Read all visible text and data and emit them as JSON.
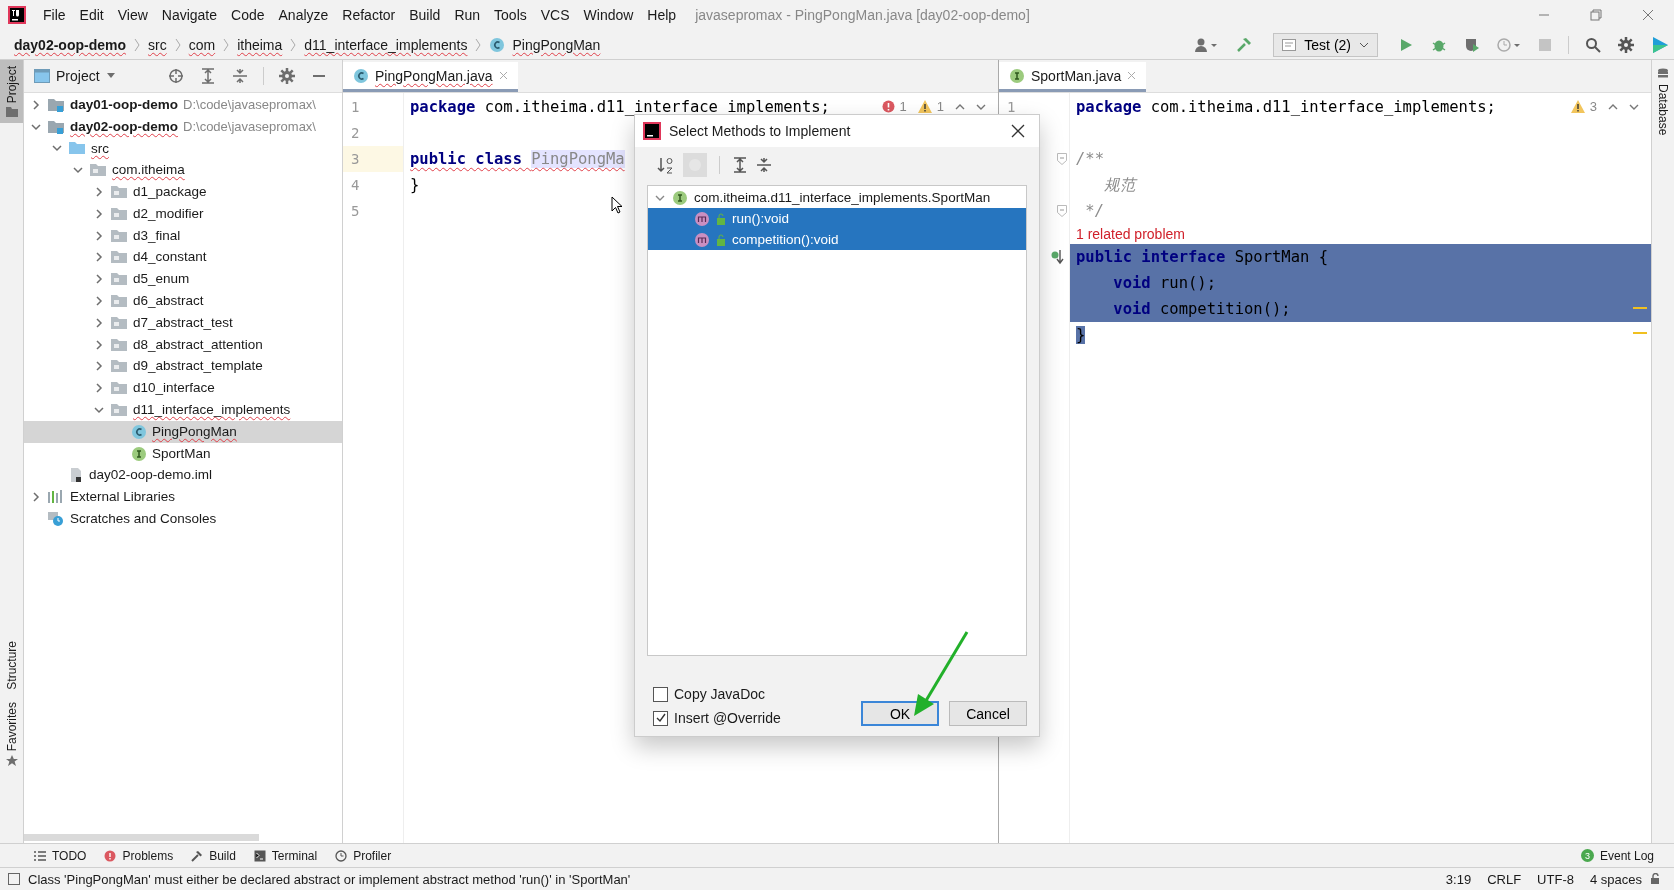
{
  "menu": [
    "File",
    "Edit",
    "View",
    "Navigate",
    "Code",
    "Analyze",
    "Refactor",
    "Build",
    "Run",
    "Tools",
    "VCS",
    "Window",
    "Help"
  ],
  "window": {
    "title": "javasepromax - PingPongMan.java [day02-oop-demo]"
  },
  "breadcrumbs": [
    {
      "label": "day02-oop-demo",
      "kind": "module",
      "error": true
    },
    {
      "label": "src",
      "kind": "plain",
      "error": true
    },
    {
      "label": "com",
      "kind": "plain",
      "error": true
    },
    {
      "label": "itheima",
      "kind": "plain",
      "error": true
    },
    {
      "label": "d11_interface_implements",
      "kind": "plain",
      "error": true
    },
    {
      "label": "PingPongMan",
      "kind": "class",
      "error": true
    }
  ],
  "run_config": {
    "label": "Test (2)"
  },
  "left_stripe": [
    {
      "label": "Project",
      "selected": true
    },
    {
      "label": "Structure",
      "selected": false
    },
    {
      "label": "Favorites",
      "selected": false
    }
  ],
  "right_stripe": [
    {
      "label": "Database"
    }
  ],
  "project": {
    "title": "Project",
    "tree": [
      {
        "label": "day01-oop-demo",
        "kind": "module",
        "path": "D:\\code\\javasepromax\\",
        "expanded": false,
        "selected": false,
        "error": false
      },
      {
        "label": "day02-oop-demo",
        "kind": "module",
        "path": "D:\\code\\javasepromax\\",
        "expanded": true,
        "selected": false,
        "error": true,
        "children": [
          {
            "label": "src",
            "kind": "source",
            "expanded": true,
            "selected": false,
            "error": true,
            "children": [
              {
                "label": "com.itheima",
                "kind": "package",
                "expanded": true,
                "selected": false,
                "error": true,
                "children": [
                  {
                    "label": "d1_package",
                    "kind": "package",
                    "expanded": false,
                    "selected": false,
                    "error": false
                  },
                  {
                    "label": "d2_modifier",
                    "kind": "package",
                    "expanded": false,
                    "selected": false,
                    "error": false
                  },
                  {
                    "label": "d3_final",
                    "kind": "package",
                    "expanded": false,
                    "selected": false,
                    "error": false
                  },
                  {
                    "label": "d4_constant",
                    "kind": "package",
                    "expanded": false,
                    "selected": false,
                    "error": false
                  },
                  {
                    "label": "d5_enum",
                    "kind": "package",
                    "expanded": false,
                    "selected": false,
                    "error": false
                  },
                  {
                    "label": "d6_abstract",
                    "kind": "package",
                    "expanded": false,
                    "selected": false,
                    "error": false
                  },
                  {
                    "label": "d7_abstract_test",
                    "kind": "package",
                    "expanded": false,
                    "selected": false,
                    "error": false
                  },
                  {
                    "label": "d8_abstract_attention",
                    "kind": "package",
                    "expanded": false,
                    "selected": false,
                    "error": false
                  },
                  {
                    "label": "d9_abstract_template",
                    "kind": "package",
                    "expanded": false,
                    "selected": false,
                    "error": false
                  },
                  {
                    "label": "d10_interface",
                    "kind": "package",
                    "expanded": false,
                    "selected": false,
                    "error": false
                  },
                  {
                    "label": "d11_interface_implements",
                    "kind": "package",
                    "expanded": true,
                    "selected": false,
                    "error": true,
                    "children": [
                      {
                        "label": "PingPongMan",
                        "kind": "class",
                        "selected": true,
                        "error": true
                      },
                      {
                        "label": "SportMan",
                        "kind": "interface",
                        "selected": false,
                        "error": false
                      }
                    ]
                  }
                ]
              }
            ]
          },
          {
            "label": "day02-oop-demo.iml",
            "kind": "file",
            "selected": false,
            "error": false
          }
        ]
      },
      {
        "label": "External Libraries",
        "kind": "libraries",
        "expanded": false,
        "selected": false,
        "error": false
      },
      {
        "label": "Scratches and Consoles",
        "kind": "scratches",
        "selected": false,
        "error": false
      }
    ]
  },
  "editor_left": {
    "tab": {
      "label": "PingPongMan.java",
      "kind": "class",
      "error": true
    },
    "errors": "1",
    "warnings": "1",
    "lines": [
      {
        "number": "1",
        "current": false,
        "error": false,
        "tokens": [
          {
            "text": "package",
            "kind": "keyword"
          },
          {
            "text": " com.itheima.d11_interface_implements;",
            "kind": "plain"
          }
        ]
      },
      {
        "number": "2",
        "current": false
      },
      {
        "number": "3",
        "current": true,
        "error": true,
        "tokens": [
          {
            "text": "public class ",
            "kind": "keyword"
          },
          {
            "text": "PingPongMa",
            "kind": "marked"
          }
        ]
      },
      {
        "number": "4",
        "current": false,
        "error": false,
        "tokens": [
          {
            "text": "}",
            "kind": "plain"
          }
        ]
      },
      {
        "number": "5",
        "current": false
      }
    ]
  },
  "editor_right": {
    "tab": {
      "label": "SportMan.java",
      "kind": "interface",
      "error": false
    },
    "warnings": "3",
    "lines": [
      {
        "kind": "code",
        "number": "1",
        "selected": false,
        "fold": false,
        "implemented": false,
        "tokens": [
          {
            "text": "package",
            "kind": "keyword"
          },
          {
            "text": " com.itheima.d11_interface_implements;",
            "kind": "plain"
          }
        ]
      },
      {
        "kind": "code",
        "selected": false,
        "fold": false,
        "implemented": false
      },
      {
        "kind": "code",
        "selected": false,
        "fold": true,
        "implemented": false,
        "tokens": [
          {
            "text": "/**",
            "kind": "comment"
          }
        ]
      },
      {
        "kind": "code",
        "selected": false,
        "fold": false,
        "implemented": false,
        "tokens": [
          {
            "text": "   规范",
            "kind": "comment"
          }
        ]
      },
      {
        "kind": "code",
        "selected": false,
        "fold": true,
        "implemented": false,
        "tokens": [
          {
            "text": " */",
            "kind": "comment"
          }
        ]
      },
      {
        "kind": "inlay",
        "text": "1 related problem"
      },
      {
        "kind": "code",
        "selected": true,
        "fold": false,
        "implemented": true,
        "tokens": [
          {
            "text": "public interface",
            "kind": "keyword"
          },
          {
            "text": " SportMan {",
            "kind": "plain"
          }
        ]
      },
      {
        "kind": "code",
        "selected": true,
        "fold": false,
        "implemented": false,
        "tokens": [
          {
            "text": "    void",
            "kind": "keyword"
          },
          {
            "text": " run();",
            "kind": "plain"
          }
        ]
      },
      {
        "kind": "code",
        "selected": true,
        "fold": false,
        "implemented": false,
        "tokens": [
          {
            "text": "    void",
            "kind": "keyword"
          },
          {
            "text": " competition();",
            "kind": "plain"
          }
        ]
      },
      {
        "kind": "code",
        "selected": true,
        "fold": false,
        "implemented": false,
        "tokens": [
          {
            "text": "}",
            "kind": "plain"
          }
        ]
      }
    ]
  },
  "dialog": {
    "title": "Select Methods to Implement",
    "tree": {
      "label": "com.itheima.d11_interface_implements.SportMan",
      "expanded": true,
      "children": [
        {
          "label": "run():void",
          "selected": true
        },
        {
          "label": "competition():void",
          "selected": true
        }
      ]
    },
    "options": [
      {
        "label": "Copy JavaDoc",
        "checked": false
      },
      {
        "label": "Insert @Override",
        "checked": true
      }
    ],
    "buttons": [
      {
        "label": "OK",
        "default": true
      },
      {
        "label": "Cancel",
        "default": false
      }
    ]
  },
  "tool_windows": [
    {
      "label": "TODO",
      "kind": "todo"
    },
    {
      "label": "Problems",
      "kind": "problems"
    },
    {
      "label": "Build",
      "kind": "build"
    },
    {
      "label": "Terminal",
      "kind": "terminal"
    },
    {
      "label": "Profiler",
      "kind": "profiler"
    }
  ],
  "event_log": {
    "label": "Event Log",
    "count": "3"
  },
  "status_bar": {
    "message": "Class 'PingPongMan' must either be declared abstract or implement abstract method 'run()' in 'SportMan'",
    "items": [
      "3:19",
      "CRLF",
      "UTF-8",
      "4 spaces"
    ]
  }
}
